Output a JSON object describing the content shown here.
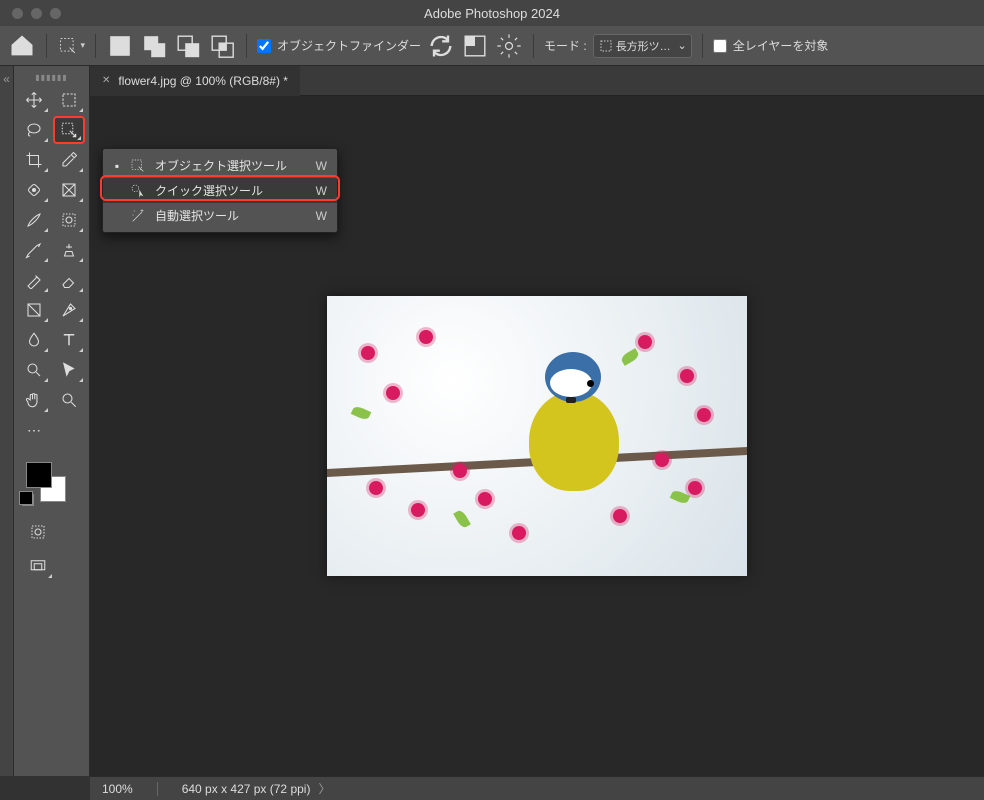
{
  "app": {
    "title": "Adobe Photoshop 2024"
  },
  "options": {
    "finder_label": "オブジェクトファインダー",
    "mode_label": "モード :",
    "mode_value": "長方形ツ…",
    "all_layers_label": "全レイヤーを対象"
  },
  "tabs": [
    {
      "title": "flower4.jpg @ 100% (RGB/8#) *"
    }
  ],
  "flyout": {
    "items": [
      {
        "label": "オブジェクト選択ツール",
        "shortcut": "W",
        "current": true
      },
      {
        "label": "クイック選択ツール",
        "shortcut": "W",
        "current": false
      },
      {
        "label": "自動選択ツール",
        "shortcut": "W",
        "current": false
      }
    ]
  },
  "status": {
    "zoom": "100%",
    "dims": "640 px x 427 px (72 ppi)"
  },
  "highlights": {
    "toolbox_tool": "object-selection-tool",
    "flyout_index": 1
  }
}
